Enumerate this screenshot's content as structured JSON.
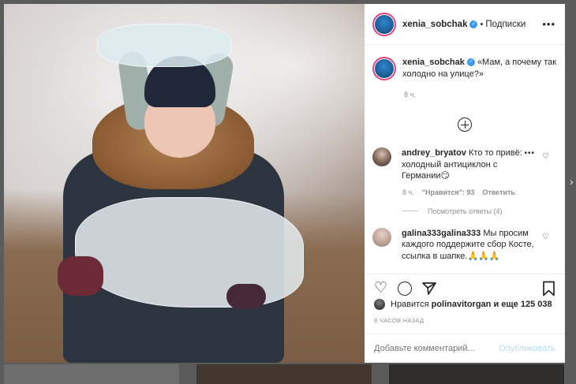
{
  "post": {
    "username": "xenia_sobchak",
    "follow_label": "Подписки",
    "dot": "•",
    "more": "•••"
  },
  "caption": {
    "username": "xenia_sobchak",
    "text": "«Мам, а почему так холодно на улице?»",
    "time": "8 ч."
  },
  "comments": [
    {
      "username": "andrey_bryatov",
      "text": "Кто то привё: холодный антициклон с Германии",
      "emoji": "😏",
      "time": "8 ч.",
      "likes_label": "\"Нравится\": 93",
      "reply_label": "Ответить",
      "view_replies": "Посмотреть ответы (4)",
      "more": "•••"
    },
    {
      "username": "galina333galina333",
      "text": "Мы просим каждого поддержите сбор Косте, ссылка в шапке.",
      "emoji": "🙏🙏🙏"
    }
  ],
  "likes": {
    "prefix": "Нравится",
    "user": "polinavitorgan",
    "suffix": "и еще 125 038"
  },
  "post_time": "8 ЧАСОВ НАЗАД",
  "add_comment": {
    "placeholder": "Добавьте комментарий...",
    "publish_label": "Опубликовать"
  },
  "icons": {
    "heart": "heart-icon",
    "comment": "comment-icon",
    "share": "share-icon",
    "save": "bookmark-icon",
    "add": "plus-circle-icon"
  },
  "colors": {
    "verified": "#3897f0",
    "story_ring": "#e0447e",
    "publish": "#b2dffc"
  }
}
